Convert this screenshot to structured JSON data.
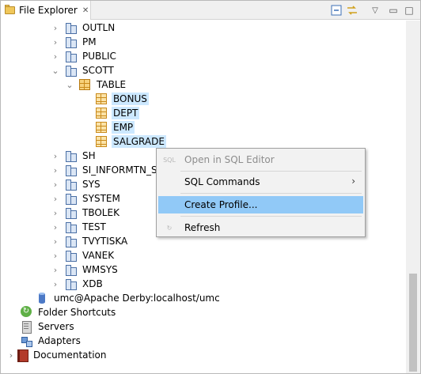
{
  "view": {
    "title": "File Explorer",
    "close_glyph": "✕",
    "toolbar": {
      "collapse_all_icon": "collapse-all-icon",
      "link_icon": "link-with-editor-icon",
      "view_menu_glyph": "▽",
      "minimize_glyph": "▭",
      "maximize_glyph": "□"
    }
  },
  "tree": {
    "schemas_before": [
      "OUTLN",
      "PM",
      "PUBLIC"
    ],
    "scott": "SCOTT",
    "table_group": "TABLE",
    "tables": [
      "BONUS",
      "DEPT",
      "EMP",
      "SALGRADE"
    ],
    "schemas_after": [
      "SH",
      "SI_INFORMTN_SC",
      "SYS",
      "SYSTEM",
      "TBOLEK",
      "TEST",
      "TVYTISKA",
      "VANEK",
      "WMSYS",
      "XDB"
    ],
    "connection": "umc@Apache Derby:localhost/umc",
    "roots": [
      "Folder Shortcuts",
      "Servers",
      "Adapters",
      "Documentation"
    ]
  },
  "context_menu": {
    "items": [
      {
        "label": "Open in SQL Editor",
        "icon_text": "SQL",
        "enabled": false
      },
      {
        "label": "SQL Commands",
        "submenu_glyph": "›",
        "enabled": true
      },
      {
        "label": "Create Profile...",
        "enabled": true,
        "highlighted": true
      },
      {
        "label": "Refresh",
        "icon_glyph": "↻",
        "enabled": true
      }
    ]
  },
  "colors": {
    "selection": "#cce8ff",
    "menu_highlight": "#91c9f7",
    "menu_background": "#f2f2f2"
  }
}
